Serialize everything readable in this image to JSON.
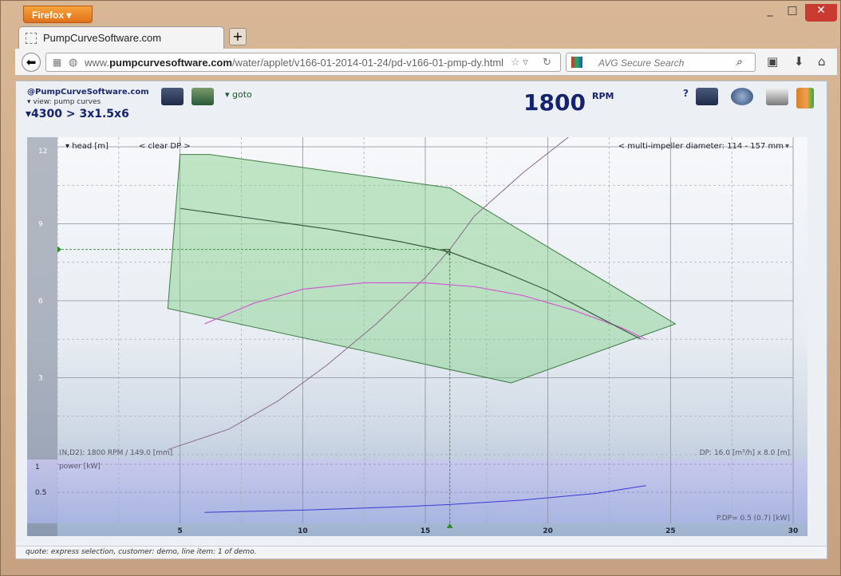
{
  "browser": {
    "menu_button": "Firefox ▾",
    "tab_title": "PumpCurveSoftware.com",
    "new_tab": "+",
    "url_prefix": "www.",
    "url_domain": "pumpcurvesoftware.com",
    "url_path": "/water/applet/v166-01-2014-01-24/pd-v166-01-pmp-dy.html",
    "search_placeholder": "AVG Secure Search",
    "minimize": "_",
    "maximize": "□",
    "close": "✕"
  },
  "applet": {
    "brand": "@PumpCurveSoftware.com",
    "view": "view: pump curves",
    "model": "4300 > 3x1.5x6",
    "goto": "goto",
    "rpm_value": "1800",
    "rpm_unit": "RPM",
    "status": "quote: express selection, customer: demo, line item: 1 of demo."
  },
  "chart_data": {
    "type": "line",
    "head_label": "head [m]",
    "clear_dp": "< clear DP >",
    "diameter_label": "< multi-impeller diameter: 114 - 157 mm",
    "power_label": "power [kW]",
    "nd_label": "(N,D2): 1800 RPM / 149.0 [mm]",
    "dp_label": "DP: 16.0 [m³/h] x 8.0 [m]",
    "pdp_label": "P.DP= 0.5 (0.7) [kW]",
    "x_ticks": [
      5,
      10,
      15,
      20,
      25,
      30
    ],
    "head_ticks": [
      3,
      6,
      9,
      12
    ],
    "power_ticks": [
      0.5,
      1
    ],
    "xlim": [
      0,
      30
    ],
    "head_ylim": [
      0,
      12
    ],
    "power_ylim": [
      0,
      1
    ],
    "envelope": [
      [
        6.2,
        11.7
      ],
      [
        5.0,
        11.7
      ],
      [
        4.5,
        5.7
      ],
      [
        18.5,
        2.8
      ],
      [
        25.2,
        5.1
      ],
      [
        16.0,
        10.4
      ],
      [
        6.2,
        11.7
      ]
    ],
    "max_diameter_curve": {
      "x": [
        5,
        8,
        11,
        14,
        16,
        18,
        20,
        22,
        24,
        25.2
      ],
      "y": [
        11.7,
        11.35,
        10.85,
        10.2,
        9.6,
        8.85,
        7.95,
        6.85,
        5.55,
        5.1
      ]
    },
    "min_diameter_curve": {
      "x": [
        4.5,
        8,
        11,
        14,
        16,
        18.5
      ],
      "y": [
        5.7,
        5.1,
        4.45,
        3.8,
        3.3,
        2.8
      ]
    },
    "selected_curve": {
      "x": [
        5,
        8,
        11,
        14,
        16,
        18,
        20,
        22,
        23.8
      ],
      "y": [
        9.6,
        9.2,
        8.8,
        8.3,
        7.9,
        7.2,
        6.4,
        5.4,
        4.5
      ]
    },
    "efficiency_curve": {
      "x": [
        6,
        8,
        10,
        12.5,
        15,
        17,
        19,
        21,
        23,
        24
      ],
      "y": [
        5.1,
        5.9,
        6.45,
        6.7,
        6.7,
        6.55,
        6.2,
        5.65,
        4.95,
        4.5
      ]
    },
    "system_curve": {
      "x": [
        4.5,
        7,
        9,
        11,
        13,
        15,
        16,
        17,
        19,
        21
      ],
      "y": [
        0.2,
        1.0,
        2.1,
        3.5,
        5.1,
        6.9,
        8.0,
        9.3,
        11.0,
        12.5
      ]
    },
    "power_curve": {
      "x": [
        6,
        10,
        14,
        16,
        19,
        22,
        24
      ],
      "y": [
        0.14,
        0.18,
        0.24,
        0.28,
        0.36,
        0.48,
        0.62
      ]
    },
    "duty_point": {
      "x": 16.0,
      "y": 8.0
    }
  }
}
